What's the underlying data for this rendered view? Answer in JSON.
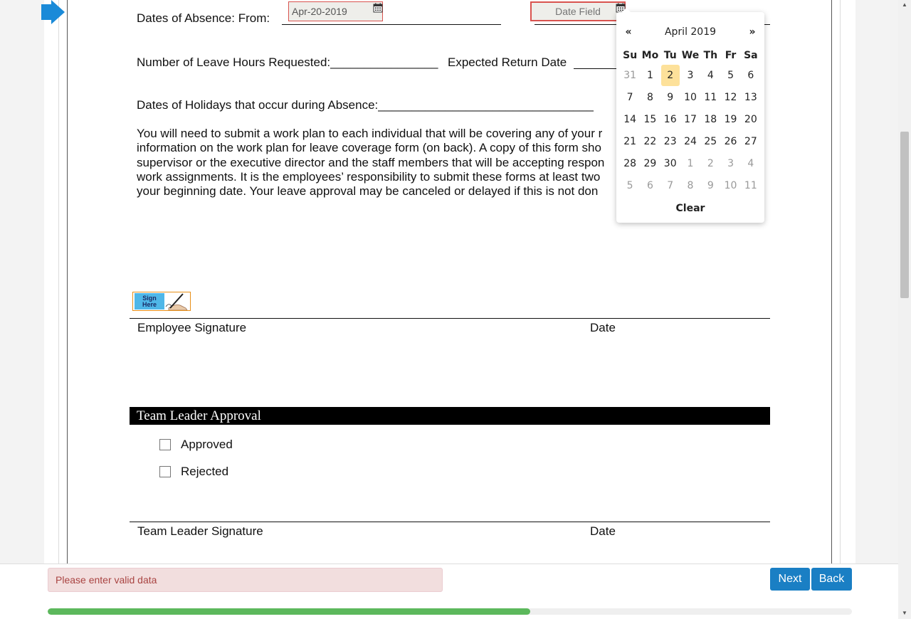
{
  "form": {
    "dates_of_absence_label": "Dates of Absence: From:",
    "from_date_value": "Apr-20-2019",
    "to_date_placeholder": "Date Field",
    "leave_hours_label": "Number of Leave Hours Requested:________________",
    "expected_return_label": "Expected Return Date",
    "holidays_label": "Dates of Holidays that occur during Absence:________________________________",
    "paragraph_lines": [
      "You will need to submit a work plan to each individual that will be covering any of your r",
      "information on the work plan for leave coverage form (on back).  A copy of this form sho",
      "supervisor or the executive director and the staff members that will be accepting respon",
      "work assignments.  It is the employees’ responsibility to submit these forms at least two",
      "your beginning date.  Your leave approval may be canceled or delayed if this is not don"
    ],
    "sign_here_line1": "Sign",
    "sign_here_line2": "Here",
    "employee_signature_label": "Employee Signature",
    "employee_date_label": "Date",
    "team_leader_section_title": "Team Leader Approval",
    "approved_label": "Approved",
    "rejected_label": "Rejected",
    "team_leader_signature_label": "Team Leader Signature",
    "team_leader_date_label": "Date"
  },
  "datepicker": {
    "prev": "«",
    "next": "»",
    "month_title": "April 2019",
    "weekdays": [
      "Su",
      "Mo",
      "Tu",
      "We",
      "Th",
      "Fr",
      "Sa"
    ],
    "weeks": [
      [
        "31",
        "1",
        "2",
        "3",
        "4",
        "5",
        "6"
      ],
      [
        "7",
        "8",
        "9",
        "10",
        "11",
        "12",
        "13"
      ],
      [
        "14",
        "15",
        "16",
        "17",
        "18",
        "19",
        "20"
      ],
      [
        "21",
        "22",
        "23",
        "24",
        "25",
        "26",
        "27"
      ],
      [
        "28",
        "29",
        "30",
        "1",
        "2",
        "3",
        "4"
      ],
      [
        "5",
        "6",
        "7",
        "8",
        "9",
        "10",
        "11"
      ]
    ],
    "highlighted_day": "2",
    "clear_label": "Clear"
  },
  "footer": {
    "error_message": "Please enter valid data",
    "next_label": "Next",
    "back_label": "Back",
    "progress_fraction": 0.6
  },
  "colors": {
    "accent": "#1a7fc4",
    "progress": "#5cb85c",
    "error_border": "#d9534f",
    "today_highlight": "#fde19a"
  }
}
